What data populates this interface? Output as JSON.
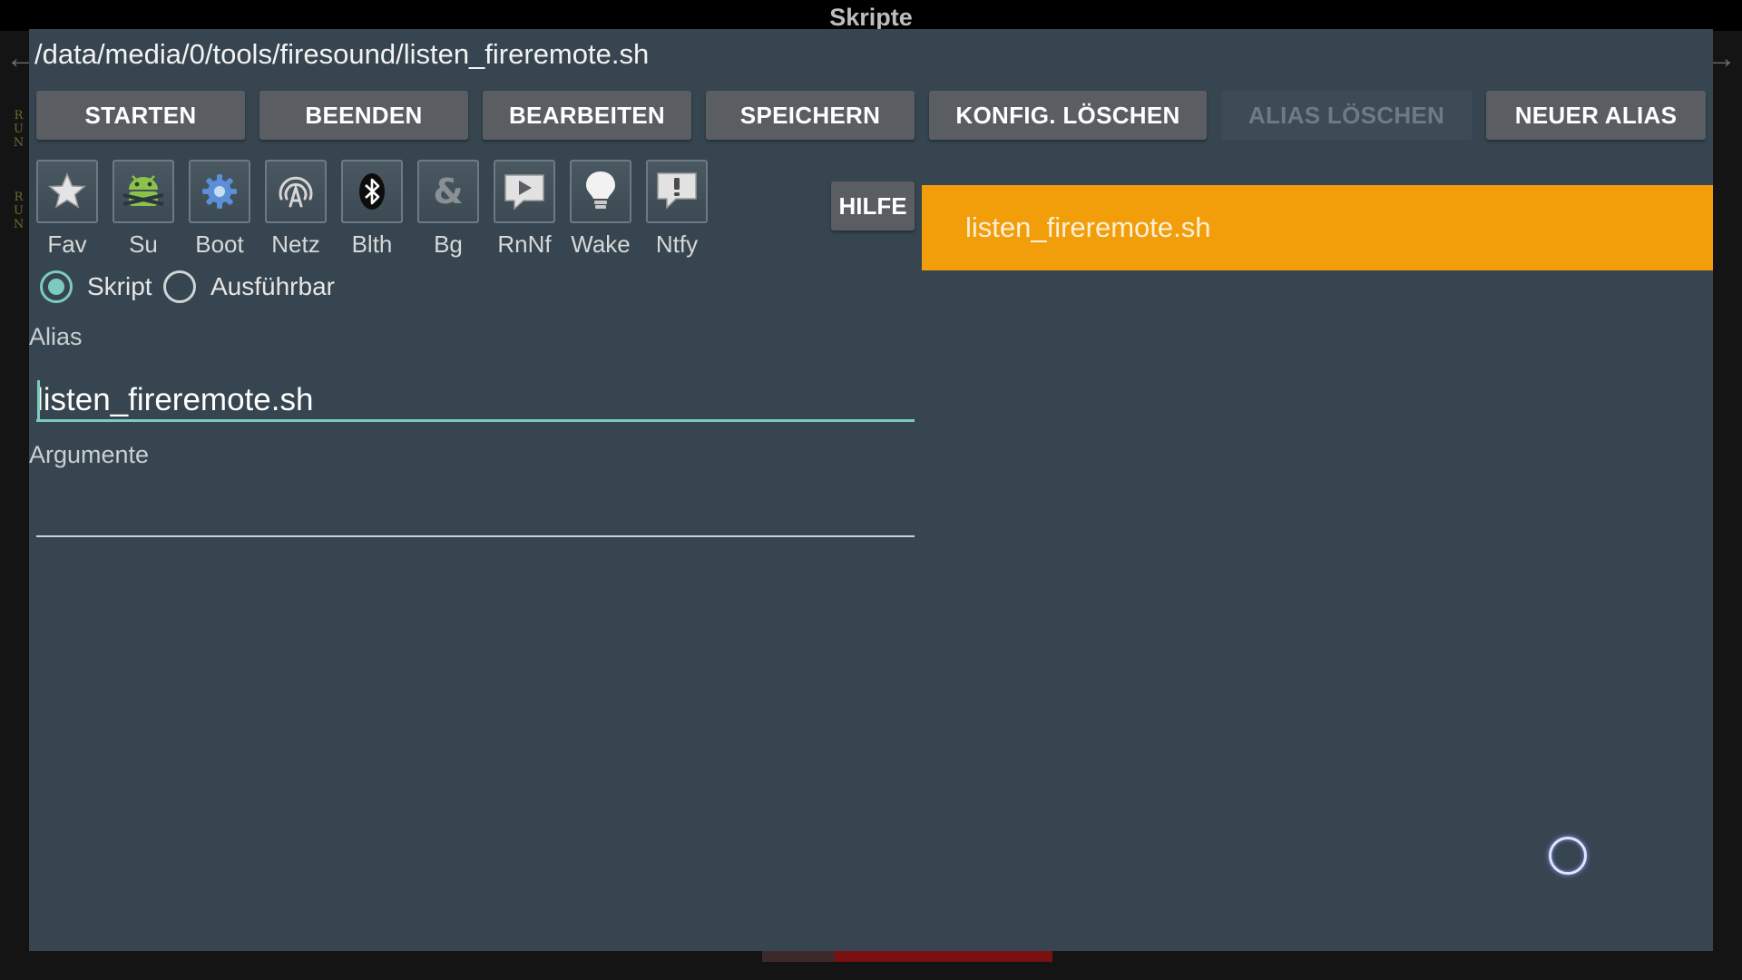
{
  "app": {
    "title": "Skripte"
  },
  "nav": {
    "back_glyph": "←",
    "forward_glyph": "→"
  },
  "side_tags": [
    "RUN",
    "RUN"
  ],
  "dialog": {
    "path": "/data/media/0/tools/firesound/listen_fireremote.sh",
    "buttons": [
      {
        "label": "STARTEN",
        "enabled": true
      },
      {
        "label": "BEENDEN",
        "enabled": true
      },
      {
        "label": "BEARBEITEN",
        "enabled": true
      },
      {
        "label": "SPEICHERN",
        "enabled": true
      },
      {
        "label": "KONFIG. LÖSCHEN",
        "enabled": true
      },
      {
        "label": "ALIAS LÖSCHEN",
        "enabled": false
      },
      {
        "label": "NEUER ALIAS",
        "enabled": true
      }
    ],
    "toggles": [
      {
        "label": "Fav",
        "icon": "star-icon"
      },
      {
        "label": "Su",
        "icon": "android-su-icon"
      },
      {
        "label": "Boot",
        "icon": "gear-icon"
      },
      {
        "label": "Netz",
        "icon": "antenna-icon"
      },
      {
        "label": "Blth",
        "icon": "bluetooth-icon"
      },
      {
        "label": "Bg",
        "icon": "ampersand-icon"
      },
      {
        "label": "RnNf",
        "icon": "notification-play-icon"
      },
      {
        "label": "Wake",
        "icon": "lightbulb-icon"
      },
      {
        "label": "Ntfy",
        "icon": "exclamation-bubble-icon"
      }
    ],
    "type_options": [
      {
        "label": "Skript",
        "checked": true
      },
      {
        "label": "Ausführbar",
        "checked": false
      }
    ],
    "alias": {
      "label": "Alias",
      "value": "listen_fireremote.sh"
    },
    "arguments": {
      "label": "Argumente",
      "value": ""
    },
    "help_label": "HILFE",
    "alias_list": [
      "listen_fireremote.sh"
    ]
  },
  "colors": {
    "dialog_bg": "#36454f",
    "accent_teal": "#7dcbc0",
    "selected_item": "#f29e0b",
    "button_bg": "#5a5d61"
  }
}
